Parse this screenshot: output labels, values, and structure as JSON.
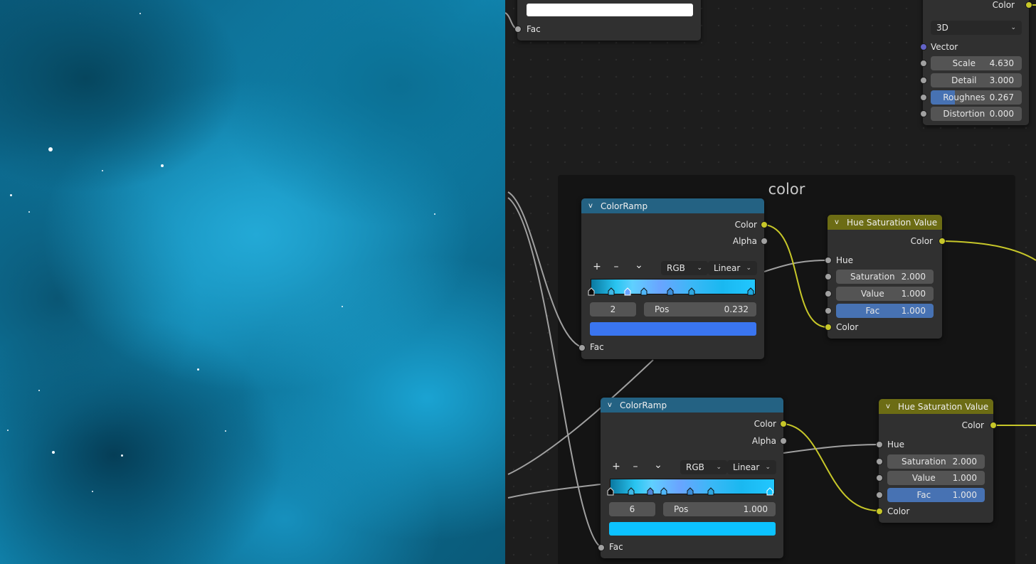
{
  "nodes": {
    "top_partial": {
      "fac_label": "Fac"
    },
    "noise": {
      "color_output": "Color",
      "dimension": "3D",
      "vector_label": "Vector",
      "fields": [
        {
          "label": "Scale",
          "value": "4.630"
        },
        {
          "label": "Detail",
          "value": "3.000"
        },
        {
          "label": "Roughnes",
          "value": "0.267",
          "fill": 0.267
        },
        {
          "label": "Distortion",
          "value": "0.000"
        }
      ]
    },
    "frame": {
      "label": "color"
    },
    "ramp1": {
      "title": "ColorRamp",
      "out_color": "Color",
      "out_alpha": "Alpha",
      "add": "+",
      "remove": "–",
      "menu": "⌄",
      "mode": "RGB",
      "interp": "Linear",
      "stop_index": "2",
      "pos_label": "Pos",
      "pos_value": "0.232",
      "swatch_color": "#3a75f0",
      "in_fac": "Fac"
    },
    "hsv1": {
      "title": "Hue Saturation Value",
      "out_color": "Color",
      "in_hue": "Hue",
      "saturation_label": "Saturation",
      "saturation_value": "2.000",
      "value_label": "Value",
      "value_value": "1.000",
      "fac_label": "Fac",
      "fac_value": "1.000",
      "in_color": "Color"
    },
    "ramp2": {
      "title": "ColorRamp",
      "out_color": "Color",
      "out_alpha": "Alpha",
      "add": "+",
      "remove": "–",
      "menu": "⌄",
      "mode": "RGB",
      "interp": "Linear",
      "stop_index": "6",
      "pos_label": "Pos",
      "pos_value": "1.000",
      "swatch_color": "#0cc2ff",
      "in_fac": "Fac"
    },
    "hsv2": {
      "title": "Hue Saturation Value",
      "out_color": "Color",
      "in_hue": "Hue",
      "saturation_label": "Saturation",
      "saturation_value": "2.000",
      "value_label": "Value",
      "value_value": "1.000",
      "fac_label": "Fac",
      "fac_value": "1.000",
      "in_color": "Color"
    }
  },
  "colors": {
    "ramp_header": "#246283",
    "hsv_header": "#6c6c14",
    "socket_color": "#c7c729",
    "socket_float": "#a1a1a1",
    "socket_vector": "#6363c7",
    "field_active": "#4772b3"
  }
}
